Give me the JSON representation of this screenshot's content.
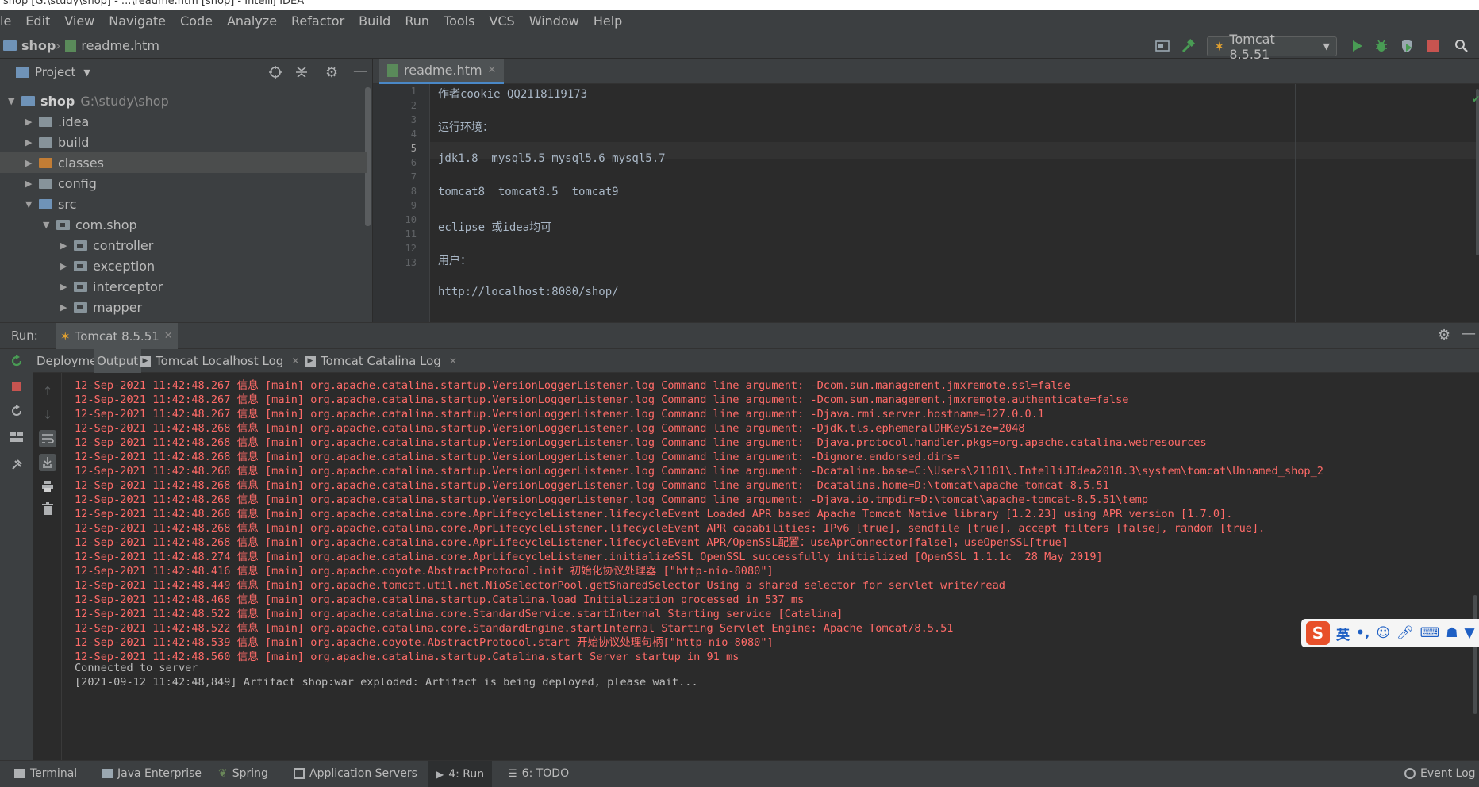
{
  "window": {
    "title": "shop [G:\\study\\shop] - ...\\readme.htm [shop] - IntelliJ IDEA"
  },
  "menu": [
    "le",
    "Edit",
    "View",
    "Navigate",
    "Code",
    "Analyze",
    "Refactor",
    "Build",
    "Run",
    "Tools",
    "VCS",
    "Window",
    "Help"
  ],
  "breadcrumb": {
    "project": "shop",
    "file": "readme.htm"
  },
  "toolbar": {
    "run_config": "Tomcat 8.5.51"
  },
  "project_panel": {
    "title": "Project",
    "tree": [
      {
        "label": "shop",
        "path": "G:\\study\\shop",
        "expanded": true
      },
      {
        "label": ".idea"
      },
      {
        "label": "build"
      },
      {
        "label": "classes"
      },
      {
        "label": "config"
      },
      {
        "label": "src"
      },
      {
        "label": "com.shop"
      },
      {
        "label": "controller"
      },
      {
        "label": "exception"
      },
      {
        "label": "interceptor"
      },
      {
        "label": "mapper"
      }
    ]
  },
  "editor": {
    "tab": "readme.htm",
    "lines": [
      {
        "n": "1",
        "text": "作者cookie QQ2118119173"
      },
      {
        "n": "2",
        "text": ""
      },
      {
        "n": "3",
        "text": "运行环境："
      },
      {
        "n": "4",
        "text": ""
      },
      {
        "n": "5",
        "text": "jdk1.8  mysql5.5 mysql5.6 mysql5.7"
      },
      {
        "n": "6",
        "text": ""
      },
      {
        "n": "7",
        "text": "tomcat8  tomcat8.5  tomcat9"
      },
      {
        "n": "8",
        "text": ""
      },
      {
        "n": "9",
        "text": "eclipse 或idea均可"
      },
      {
        "n": "10",
        "text": ""
      },
      {
        "n": "11",
        "text": "用户："
      },
      {
        "n": "12",
        "text": ""
      },
      {
        "n": "13",
        "text": "http://localhost:8080/shop/"
      }
    ]
  },
  "run_panel": {
    "label": "Run:",
    "config_tab": "Tomcat 8.5.51",
    "tabs": [
      "Deployment",
      "Output",
      "Tomcat Localhost Log",
      "Tomcat Catalina Log"
    ],
    "console": [
      "12-Sep-2021 11:42:48.267 信息 [main] org.apache.catalina.startup.VersionLoggerListener.log Command line argument: -Dcom.sun.management.jmxremote.ssl=false",
      "12-Sep-2021 11:42:48.267 信息 [main] org.apache.catalina.startup.VersionLoggerListener.log Command line argument: -Dcom.sun.management.jmxremote.authenticate=false",
      "12-Sep-2021 11:42:48.267 信息 [main] org.apache.catalina.startup.VersionLoggerListener.log Command line argument: -Djava.rmi.server.hostname=127.0.0.1",
      "12-Sep-2021 11:42:48.268 信息 [main] org.apache.catalina.startup.VersionLoggerListener.log Command line argument: -Djdk.tls.ephemeralDHKeySize=2048",
      "12-Sep-2021 11:42:48.268 信息 [main] org.apache.catalina.startup.VersionLoggerListener.log Command line argument: -Djava.protocol.handler.pkgs=org.apache.catalina.webresources",
      "12-Sep-2021 11:42:48.268 信息 [main] org.apache.catalina.startup.VersionLoggerListener.log Command line argument: -Dignore.endorsed.dirs=",
      "12-Sep-2021 11:42:48.268 信息 [main] org.apache.catalina.startup.VersionLoggerListener.log Command line argument: -Dcatalina.base=C:\\Users\\21181\\.IntelliJIdea2018.3\\system\\tomcat\\Unnamed_shop_2",
      "12-Sep-2021 11:42:48.268 信息 [main] org.apache.catalina.startup.VersionLoggerListener.log Command line argument: -Dcatalina.home=D:\\tomcat\\apache-tomcat-8.5.51",
      "12-Sep-2021 11:42:48.268 信息 [main] org.apache.catalina.startup.VersionLoggerListener.log Command line argument: -Djava.io.tmpdir=D:\\tomcat\\apache-tomcat-8.5.51\\temp",
      "12-Sep-2021 11:42:48.268 信息 [main] org.apache.catalina.core.AprLifecycleListener.lifecycleEvent Loaded APR based Apache Tomcat Native library [1.2.23] using APR version [1.7.0].",
      "12-Sep-2021 11:42:48.268 信息 [main] org.apache.catalina.core.AprLifecycleListener.lifecycleEvent APR capabilities: IPv6 [true], sendfile [true], accept filters [false], random [true].",
      "12-Sep-2021 11:42:48.268 信息 [main] org.apache.catalina.core.AprLifecycleListener.lifecycleEvent APR/OpenSSL配置：useAprConnector[false]，useOpenSSL[true]",
      "12-Sep-2021 11:42:48.274 信息 [main] org.apache.catalina.core.AprLifecycleListener.initializeSSL OpenSSL successfully initialized [OpenSSL 1.1.1c  28 May 2019]",
      "12-Sep-2021 11:42:48.416 信息 [main] org.apache.coyote.AbstractProtocol.init 初始化协议处理器 [\"http-nio-8080\"]",
      "12-Sep-2021 11:42:48.449 信息 [main] org.apache.tomcat.util.net.NioSelectorPool.getSharedSelector Using a shared selector for servlet write/read",
      "12-Sep-2021 11:42:48.468 信息 [main] org.apache.catalina.startup.Catalina.load Initialization processed in 537 ms",
      "12-Sep-2021 11:42:48.522 信息 [main] org.apache.catalina.core.StandardService.startInternal Starting service [Catalina]",
      "12-Sep-2021 11:42:48.522 信息 [main] org.apache.catalina.core.StandardEngine.startInternal Starting Servlet Engine: Apache Tomcat/8.5.51",
      "12-Sep-2021 11:42:48.539 信息 [main] org.apache.coyote.AbstractProtocol.start 开始协议处理句柄[\"http-nio-8080\"]",
      "12-Sep-2021 11:42:48.560 信息 [main] org.apache.catalina.startup.Catalina.start Server startup in 91 ms"
    ],
    "console_plain": [
      "Connected to server",
      "[2021-09-12 11:42:48,849] Artifact shop:war exploded: Artifact is being deployed, please wait..."
    ]
  },
  "ime": {
    "mode": "英",
    "punct": "•,"
  },
  "bottom_bar": [
    {
      "key": "terminal",
      "label": "Terminal"
    },
    {
      "key": "java-ee",
      "label": "Java Enterprise"
    },
    {
      "key": "spring",
      "label": "Spring"
    },
    {
      "key": "app-servers",
      "label": "Application Servers"
    },
    {
      "key": "run",
      "label": "4: Run"
    },
    {
      "key": "todo",
      "label": "6: TODO"
    },
    {
      "key": "event-log",
      "label": "Event Log"
    }
  ],
  "colors": {
    "error_text": "#ff6b68",
    "bg": "#2b2b2b",
    "panel": "#3c3f41",
    "accent": "#4a88c7",
    "run_green": "#499c54",
    "stop_red": "#c75450"
  }
}
